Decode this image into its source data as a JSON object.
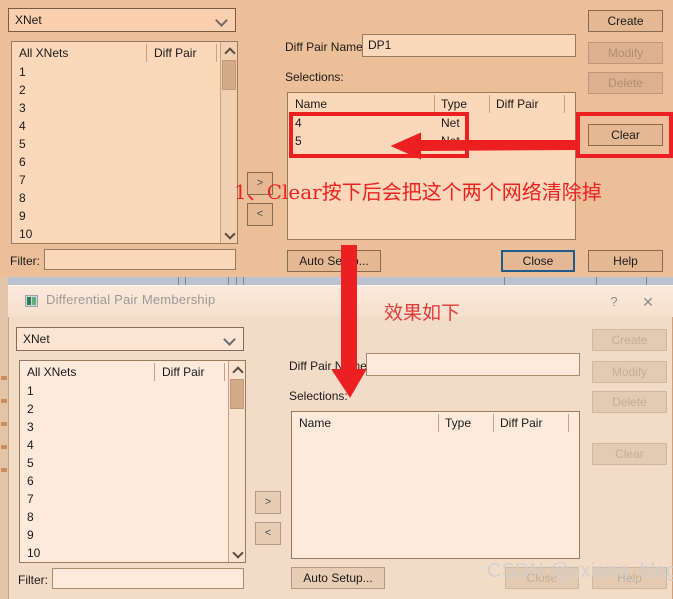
{
  "dialog_top": {
    "net_class_combo": {
      "value": "XNet",
      "chevron_icon": "chevron-down-icon"
    },
    "left_list": {
      "headers": [
        "All XNets",
        "Diff Pair"
      ],
      "rows": [
        "1",
        "2",
        "3",
        "4",
        "5",
        "6",
        "7",
        "8",
        "9",
        "10"
      ],
      "scrollbar": {
        "up_icon": "chevron-up-icon",
        "down_icon": "chevron-down-icon"
      }
    },
    "filter_label": "Filter:",
    "filter_value": "",
    "move_right_button": ">",
    "move_left_button": "<",
    "diff_pair_name_label": "Diff Pair Name:",
    "diff_pair_name_value": "DP1",
    "selections_label": "Selections:",
    "selections_table": {
      "headers": [
        "Name",
        "Type",
        "Diff Pair"
      ],
      "rows": [
        {
          "name": "4",
          "type": "Net",
          "diff_pair": ""
        },
        {
          "name": "5",
          "type": "Net",
          "diff_pair": ""
        }
      ]
    },
    "buttons": {
      "create": "Create",
      "modify": "Modify",
      "delete": "Delete",
      "clear": "Clear",
      "auto_setup": "Auto Setup...",
      "close": "Close",
      "help": "Help"
    }
  },
  "dialog_bottom": {
    "titlebar": {
      "title": "Differential Pair Membership",
      "app_icon": "app-window-icon",
      "help_icon": "?",
      "close_icon": "✕"
    },
    "net_class_combo": {
      "value": "XNet",
      "chevron_icon": "chevron-down-icon"
    },
    "left_list": {
      "headers": [
        "All XNets",
        "Diff Pair"
      ],
      "rows": [
        "1",
        "2",
        "3",
        "4",
        "5",
        "6",
        "7",
        "8",
        "9",
        "10"
      ],
      "scrollbar": {
        "up_icon": "chevron-up-icon",
        "down_icon": "chevron-down-icon"
      }
    },
    "filter_label": "Filter:",
    "filter_value": "",
    "move_right_button": ">",
    "move_left_button": "<",
    "diff_pair_name_label": "Diff Pair Name:",
    "diff_pair_name_value": "",
    "selections_label": "Selections:",
    "selections_table": {
      "headers": [
        "Name",
        "Type",
        "Diff Pair"
      ],
      "rows": []
    },
    "buttons": {
      "create": "Create",
      "modify": "Modify",
      "delete": "Delete",
      "clear": "Clear",
      "auto_setup": "Auto Setup...",
      "close": "Close",
      "help": "Help"
    }
  },
  "annotations": {
    "step1_text": "1、Clear按下后会把这个两个网络清除掉",
    "result_text": "效果如下",
    "color": "#ec2020"
  },
  "watermark": "CSDN @uxiang_blog"
}
